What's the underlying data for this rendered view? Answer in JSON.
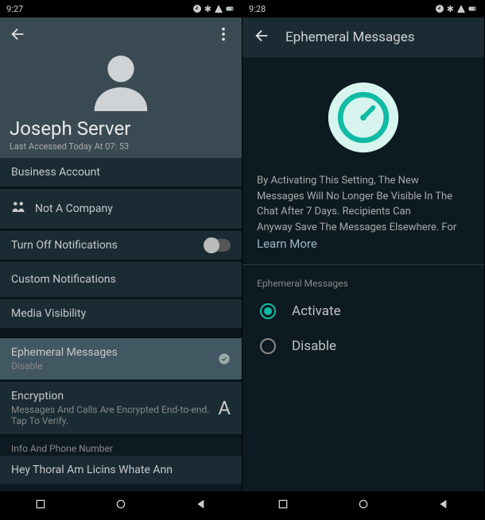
{
  "left": {
    "status_time": "9:27",
    "alarm_icon": "alarm",
    "contact_name": "Joseph Server",
    "last_seen": "Last Accessed Today At 07: 53",
    "business_label": "Business Account",
    "not_company": "Not A Company",
    "notifications": "Turn Off Notifications",
    "custom_notifications": "Custom Notifications",
    "media_visibility": "Media Visibility",
    "ephemeral_title": "Ephemeral Messages",
    "ephemeral_state": "Disable",
    "encryption_title": "Encryption",
    "encryption_sub": "Messages And Calls Are Encrypted End-to-end. Tap To Verify.",
    "encryption_trailing": "A",
    "info_section": "Info And Phone Number",
    "info_text": "Hey Thoral Am Licins Whate Ann"
  },
  "right": {
    "status_time": "9:28",
    "title": "Ephemeral Messages",
    "desc_line1": "By Activating This Setting, The New",
    "desc_line2": "Messages Will No Longer Be Visible In The",
    "desc_line3": "Chat After 7 Days. Recipients Can",
    "desc_line4": "Anyway Save The Messages Elsewhere. For",
    "learn_more": "Learn More",
    "option_header": "Ephemeral Messages",
    "option_activate": "Activate",
    "option_disable": "Disable"
  }
}
